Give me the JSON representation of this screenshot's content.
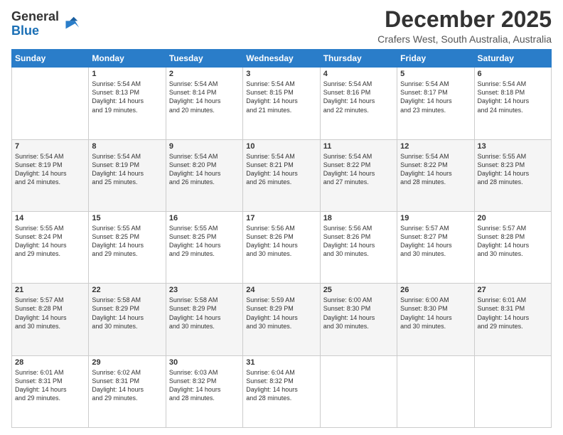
{
  "logo": {
    "line1": "General",
    "line2": "Blue"
  },
  "title": "December 2025",
  "subtitle": "Crafers West, South Australia, Australia",
  "days_of_week": [
    "Sunday",
    "Monday",
    "Tuesday",
    "Wednesday",
    "Thursday",
    "Friday",
    "Saturday"
  ],
  "weeks": [
    [
      {
        "day": "",
        "info": ""
      },
      {
        "day": "1",
        "info": "Sunrise: 5:54 AM\nSunset: 8:13 PM\nDaylight: 14 hours\nand 19 minutes."
      },
      {
        "day": "2",
        "info": "Sunrise: 5:54 AM\nSunset: 8:14 PM\nDaylight: 14 hours\nand 20 minutes."
      },
      {
        "day": "3",
        "info": "Sunrise: 5:54 AM\nSunset: 8:15 PM\nDaylight: 14 hours\nand 21 minutes."
      },
      {
        "day": "4",
        "info": "Sunrise: 5:54 AM\nSunset: 8:16 PM\nDaylight: 14 hours\nand 22 minutes."
      },
      {
        "day": "5",
        "info": "Sunrise: 5:54 AM\nSunset: 8:17 PM\nDaylight: 14 hours\nand 23 minutes."
      },
      {
        "day": "6",
        "info": "Sunrise: 5:54 AM\nSunset: 8:18 PM\nDaylight: 14 hours\nand 24 minutes."
      }
    ],
    [
      {
        "day": "7",
        "info": "Sunrise: 5:54 AM\nSunset: 8:19 PM\nDaylight: 14 hours\nand 24 minutes."
      },
      {
        "day": "8",
        "info": "Sunrise: 5:54 AM\nSunset: 8:19 PM\nDaylight: 14 hours\nand 25 minutes."
      },
      {
        "day": "9",
        "info": "Sunrise: 5:54 AM\nSunset: 8:20 PM\nDaylight: 14 hours\nand 26 minutes."
      },
      {
        "day": "10",
        "info": "Sunrise: 5:54 AM\nSunset: 8:21 PM\nDaylight: 14 hours\nand 26 minutes."
      },
      {
        "day": "11",
        "info": "Sunrise: 5:54 AM\nSunset: 8:22 PM\nDaylight: 14 hours\nand 27 minutes."
      },
      {
        "day": "12",
        "info": "Sunrise: 5:54 AM\nSunset: 8:22 PM\nDaylight: 14 hours\nand 28 minutes."
      },
      {
        "day": "13",
        "info": "Sunrise: 5:55 AM\nSunset: 8:23 PM\nDaylight: 14 hours\nand 28 minutes."
      }
    ],
    [
      {
        "day": "14",
        "info": "Sunrise: 5:55 AM\nSunset: 8:24 PM\nDaylight: 14 hours\nand 29 minutes."
      },
      {
        "day": "15",
        "info": "Sunrise: 5:55 AM\nSunset: 8:25 PM\nDaylight: 14 hours\nand 29 minutes."
      },
      {
        "day": "16",
        "info": "Sunrise: 5:55 AM\nSunset: 8:25 PM\nDaylight: 14 hours\nand 29 minutes."
      },
      {
        "day": "17",
        "info": "Sunrise: 5:56 AM\nSunset: 8:26 PM\nDaylight: 14 hours\nand 30 minutes."
      },
      {
        "day": "18",
        "info": "Sunrise: 5:56 AM\nSunset: 8:26 PM\nDaylight: 14 hours\nand 30 minutes."
      },
      {
        "day": "19",
        "info": "Sunrise: 5:57 AM\nSunset: 8:27 PM\nDaylight: 14 hours\nand 30 minutes."
      },
      {
        "day": "20",
        "info": "Sunrise: 5:57 AM\nSunset: 8:28 PM\nDaylight: 14 hours\nand 30 minutes."
      }
    ],
    [
      {
        "day": "21",
        "info": "Sunrise: 5:57 AM\nSunset: 8:28 PM\nDaylight: 14 hours\nand 30 minutes."
      },
      {
        "day": "22",
        "info": "Sunrise: 5:58 AM\nSunset: 8:29 PM\nDaylight: 14 hours\nand 30 minutes."
      },
      {
        "day": "23",
        "info": "Sunrise: 5:58 AM\nSunset: 8:29 PM\nDaylight: 14 hours\nand 30 minutes."
      },
      {
        "day": "24",
        "info": "Sunrise: 5:59 AM\nSunset: 8:29 PM\nDaylight: 14 hours\nand 30 minutes."
      },
      {
        "day": "25",
        "info": "Sunrise: 6:00 AM\nSunset: 8:30 PM\nDaylight: 14 hours\nand 30 minutes."
      },
      {
        "day": "26",
        "info": "Sunrise: 6:00 AM\nSunset: 8:30 PM\nDaylight: 14 hours\nand 30 minutes."
      },
      {
        "day": "27",
        "info": "Sunrise: 6:01 AM\nSunset: 8:31 PM\nDaylight: 14 hours\nand 29 minutes."
      }
    ],
    [
      {
        "day": "28",
        "info": "Sunrise: 6:01 AM\nSunset: 8:31 PM\nDaylight: 14 hours\nand 29 minutes."
      },
      {
        "day": "29",
        "info": "Sunrise: 6:02 AM\nSunset: 8:31 PM\nDaylight: 14 hours\nand 29 minutes."
      },
      {
        "day": "30",
        "info": "Sunrise: 6:03 AM\nSunset: 8:32 PM\nDaylight: 14 hours\nand 28 minutes."
      },
      {
        "day": "31",
        "info": "Sunrise: 6:04 AM\nSunset: 8:32 PM\nDaylight: 14 hours\nand 28 minutes."
      },
      {
        "day": "",
        "info": ""
      },
      {
        "day": "",
        "info": ""
      },
      {
        "day": "",
        "info": ""
      }
    ]
  ]
}
